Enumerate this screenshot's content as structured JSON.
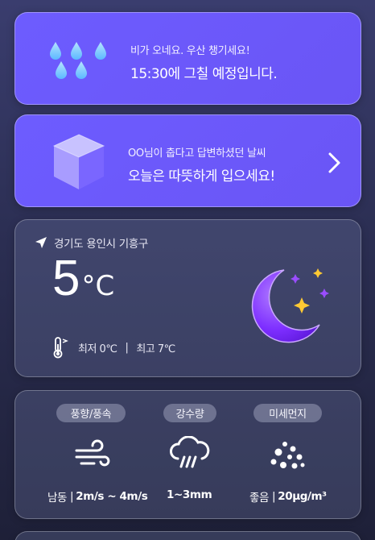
{
  "rain_card": {
    "line1": "비가 오네요. 우산 챙기세요!",
    "line2": "15:30에 그칠 예정입니다.",
    "icon": "raindrops-icon"
  },
  "outfit_card": {
    "line1": "OO님이 춥다고 답변하셨던 날씨",
    "line2": "오늘은 따뜻하게 입으세요!",
    "icon": "cube-icon",
    "action_icon": "chevron-right-icon"
  },
  "weather_card": {
    "location": "경기도 용인시 기흥구",
    "temperature": "5",
    "unit": "°C",
    "min_label": "최저 0℃",
    "max_label": "최고 7℃",
    "separator": "|",
    "icon": "moon-stars-icon"
  },
  "details": {
    "wind": {
      "label": "풍향/풍속",
      "direction": "남동",
      "separator": "|",
      "value": "2m/s ~ 4m/s",
      "icon": "wind-icon"
    },
    "precip": {
      "label": "강수량",
      "value": "1~3mm",
      "icon": "rain-cloud-icon"
    },
    "dust": {
      "label": "미세먼지",
      "status": "좋음",
      "separator": "|",
      "value": "20μg/m³",
      "icon": "dust-icon"
    }
  },
  "colors": {
    "accent_purple": "#6d5cff",
    "moon": "#8a3cff",
    "star": "#ffc933"
  }
}
